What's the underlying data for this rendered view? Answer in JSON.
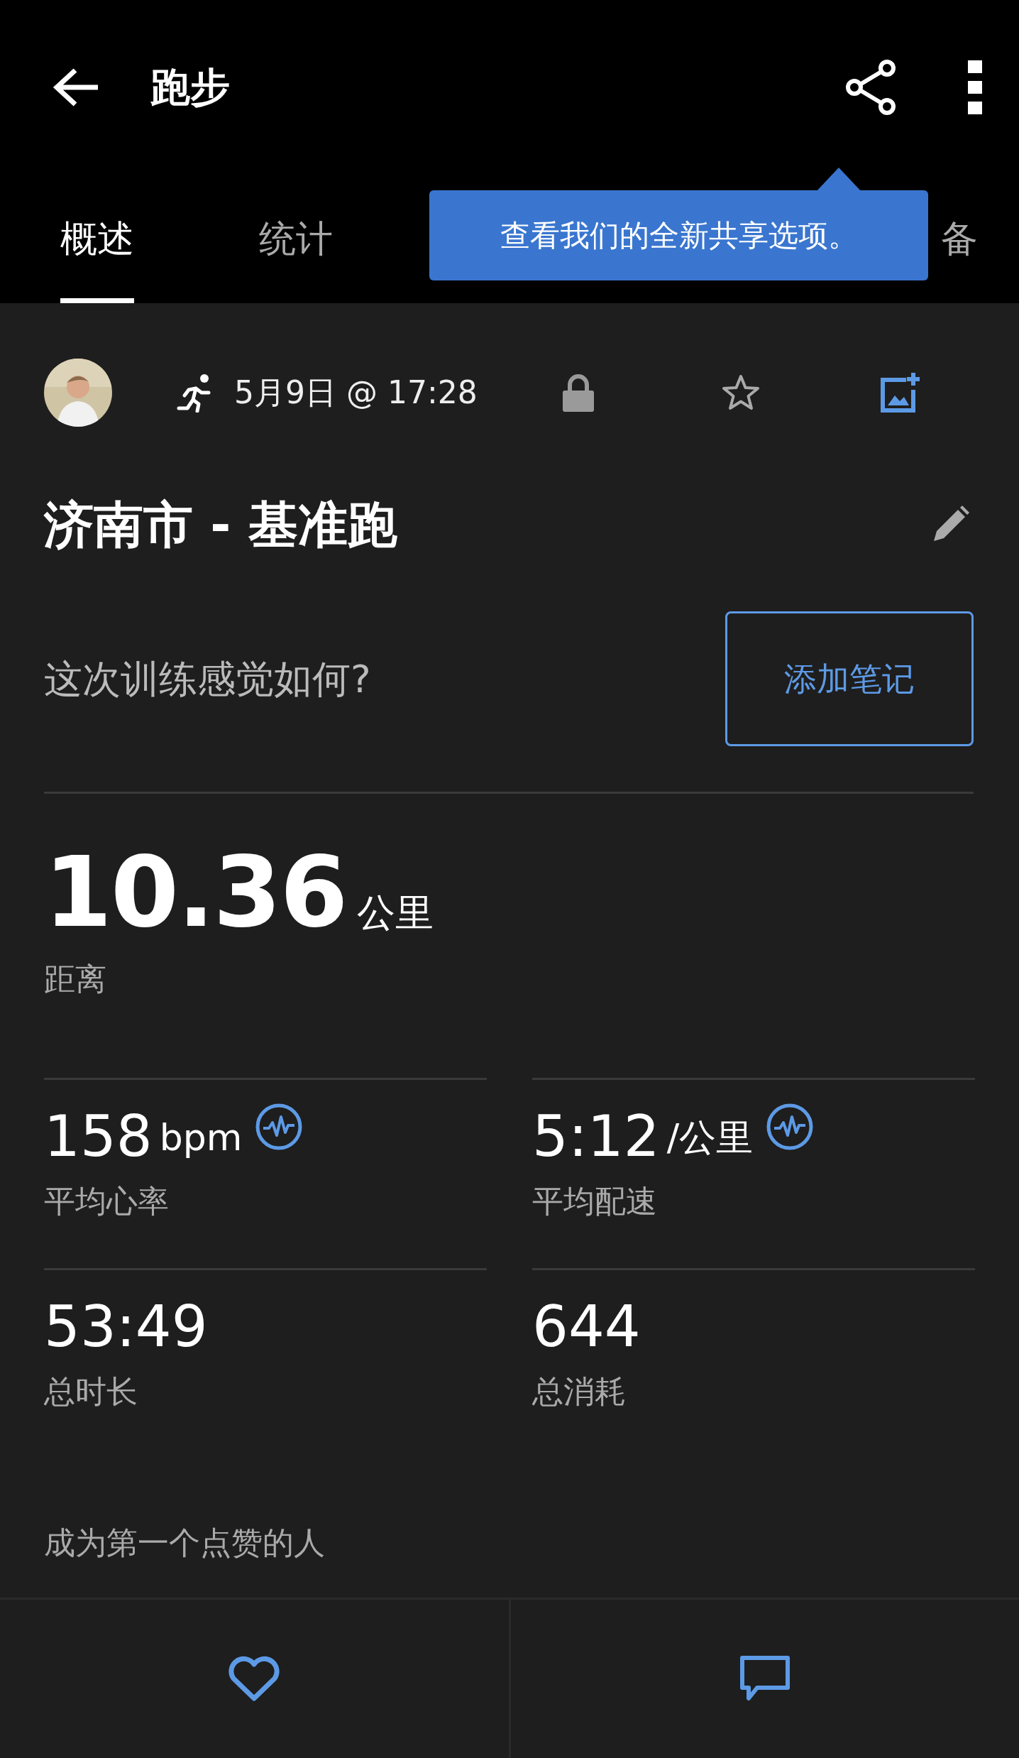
{
  "app_bar": {
    "title": "跑步"
  },
  "tabs": [
    {
      "label": "概述",
      "selected": true
    },
    {
      "label": "统计",
      "selected": false
    },
    {
      "label": "备",
      "selected": false
    }
  ],
  "tooltip": {
    "text": "查看我们的全新共享选项。"
  },
  "activity": {
    "date": "5月9日 @ 17:28",
    "title": "济南市 - 基准跑"
  },
  "feeling": {
    "question": "这次训练感觉如何?",
    "button": "添加笔记"
  },
  "distance": {
    "value": "10.36",
    "unit": "公里",
    "label": "距离"
  },
  "stats": [
    {
      "value": "158",
      "unit": "bpm",
      "label": "平均心率",
      "kind": "chart"
    },
    {
      "value": "5:12",
      "unit": "/公里",
      "label": "平均配速",
      "kind": "chart"
    },
    {
      "value": "53:49",
      "label": "总时长",
      "kind": "plain"
    },
    {
      "value": "644",
      "label": "总消耗",
      "kind": "plain"
    }
  ],
  "likes": {
    "text": "成为第一个点赞的人"
  }
}
